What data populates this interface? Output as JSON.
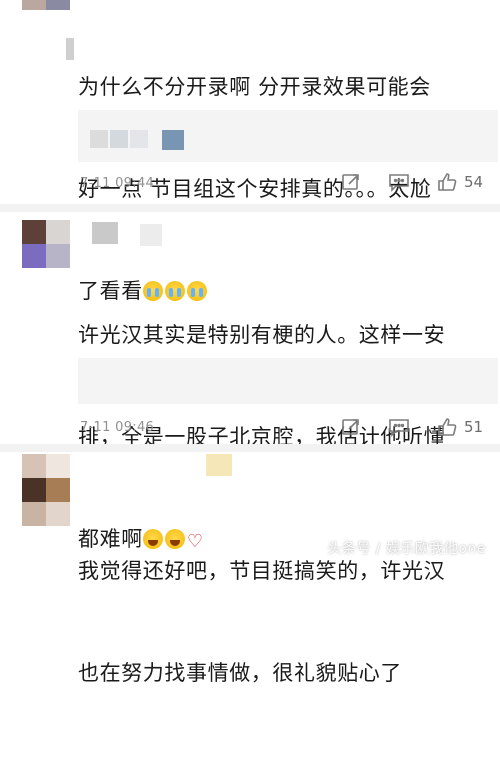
{
  "comments": [
    {
      "text_lines": [
        "为什么不分开录啊 分开录效果可能会",
        "好一点 节目组这个安排真的。。。太尬",
        "了看看"
      ],
      "emoji": [
        "cry-laugh-emoji",
        "cry-laugh-emoji",
        "cry-laugh-emoji"
      ],
      "time": "7-11 09:44",
      "likes": "54"
    },
    {
      "text_lines": [
        "许光汉其实是特别有梗的人。这样一安",
        "排，全是一股子北京腔，我估计他听懂",
        "都难啊"
      ],
      "emoji": [
        "loudly-crying-emoji",
        "loudly-crying-emoji",
        "broken-heart-emoji"
      ],
      "time": "7-11 09:46",
      "likes": "51"
    },
    {
      "text_lines": [
        "我觉得还好吧，节目挺搞笑的，许光汉",
        "也在努力找事情做，很礼貌贴心了"
      ],
      "emoji": []
    }
  ],
  "watermark": "头条号 / 娱乐欧我他one",
  "colors": {
    "meta_gray": "#8f8f8f",
    "quote_bg": "#f4f4f4",
    "divider": "#f2f2f2"
  },
  "icons": [
    "share-icon",
    "comment-icon",
    "like-icon"
  ]
}
